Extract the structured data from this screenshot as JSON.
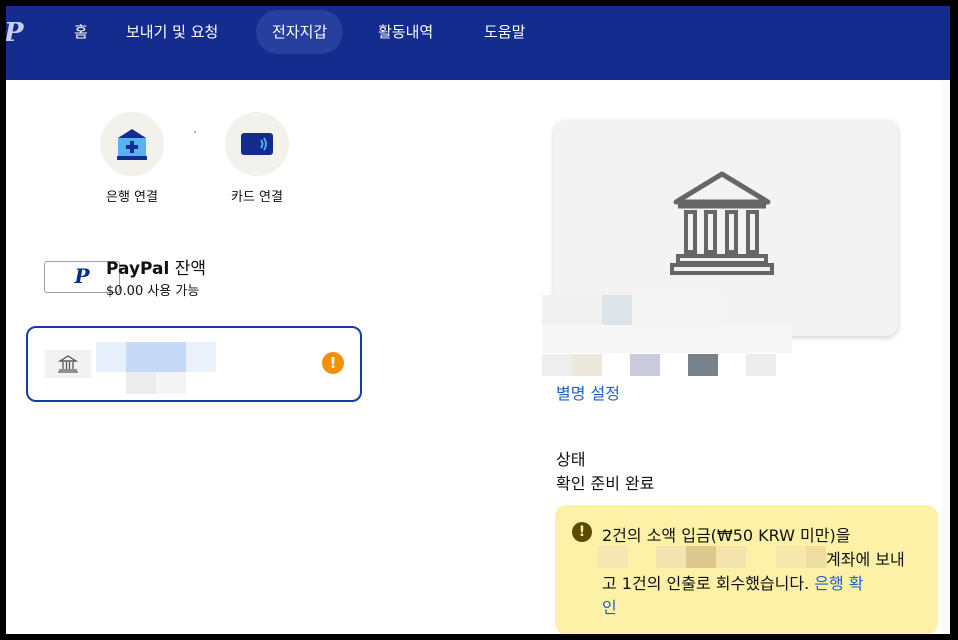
{
  "nav": {
    "logo": "P",
    "items": [
      {
        "label": "홈"
      },
      {
        "label": "보내기 및 요청"
      },
      {
        "label": "전자지갑"
      },
      {
        "label": "활동내역"
      },
      {
        "label": "도움말"
      }
    ],
    "active_index": 2
  },
  "quick_actions": {
    "link_bank": "은행 연결",
    "link_card": "카드 연결"
  },
  "balance": {
    "brand": "PayPal",
    "title_suffix": "잔액",
    "available": "$0.00 사용 가능",
    "card_logo": "P"
  },
  "selected_bank": {
    "warning_symbol": "!"
  },
  "detail": {
    "nickname_link": "별명 설정",
    "status_label": "상태",
    "status_value": "확인 준비 완료",
    "alert": {
      "icon": "!",
      "line1": "2건의 소액 입금(₩50 KRW 미만)을",
      "line2_end": "계좌에 보내",
      "line3_text": "고 1건의 인출로 회수했습니다. ",
      "line3_link": "은행 확",
      "line4_link": "인"
    }
  },
  "colors": {
    "nav_bg": "#142c8e",
    "accent_link": "#1d62c9",
    "alert_bg": "#fdf1a8",
    "warning": "#f29100"
  }
}
